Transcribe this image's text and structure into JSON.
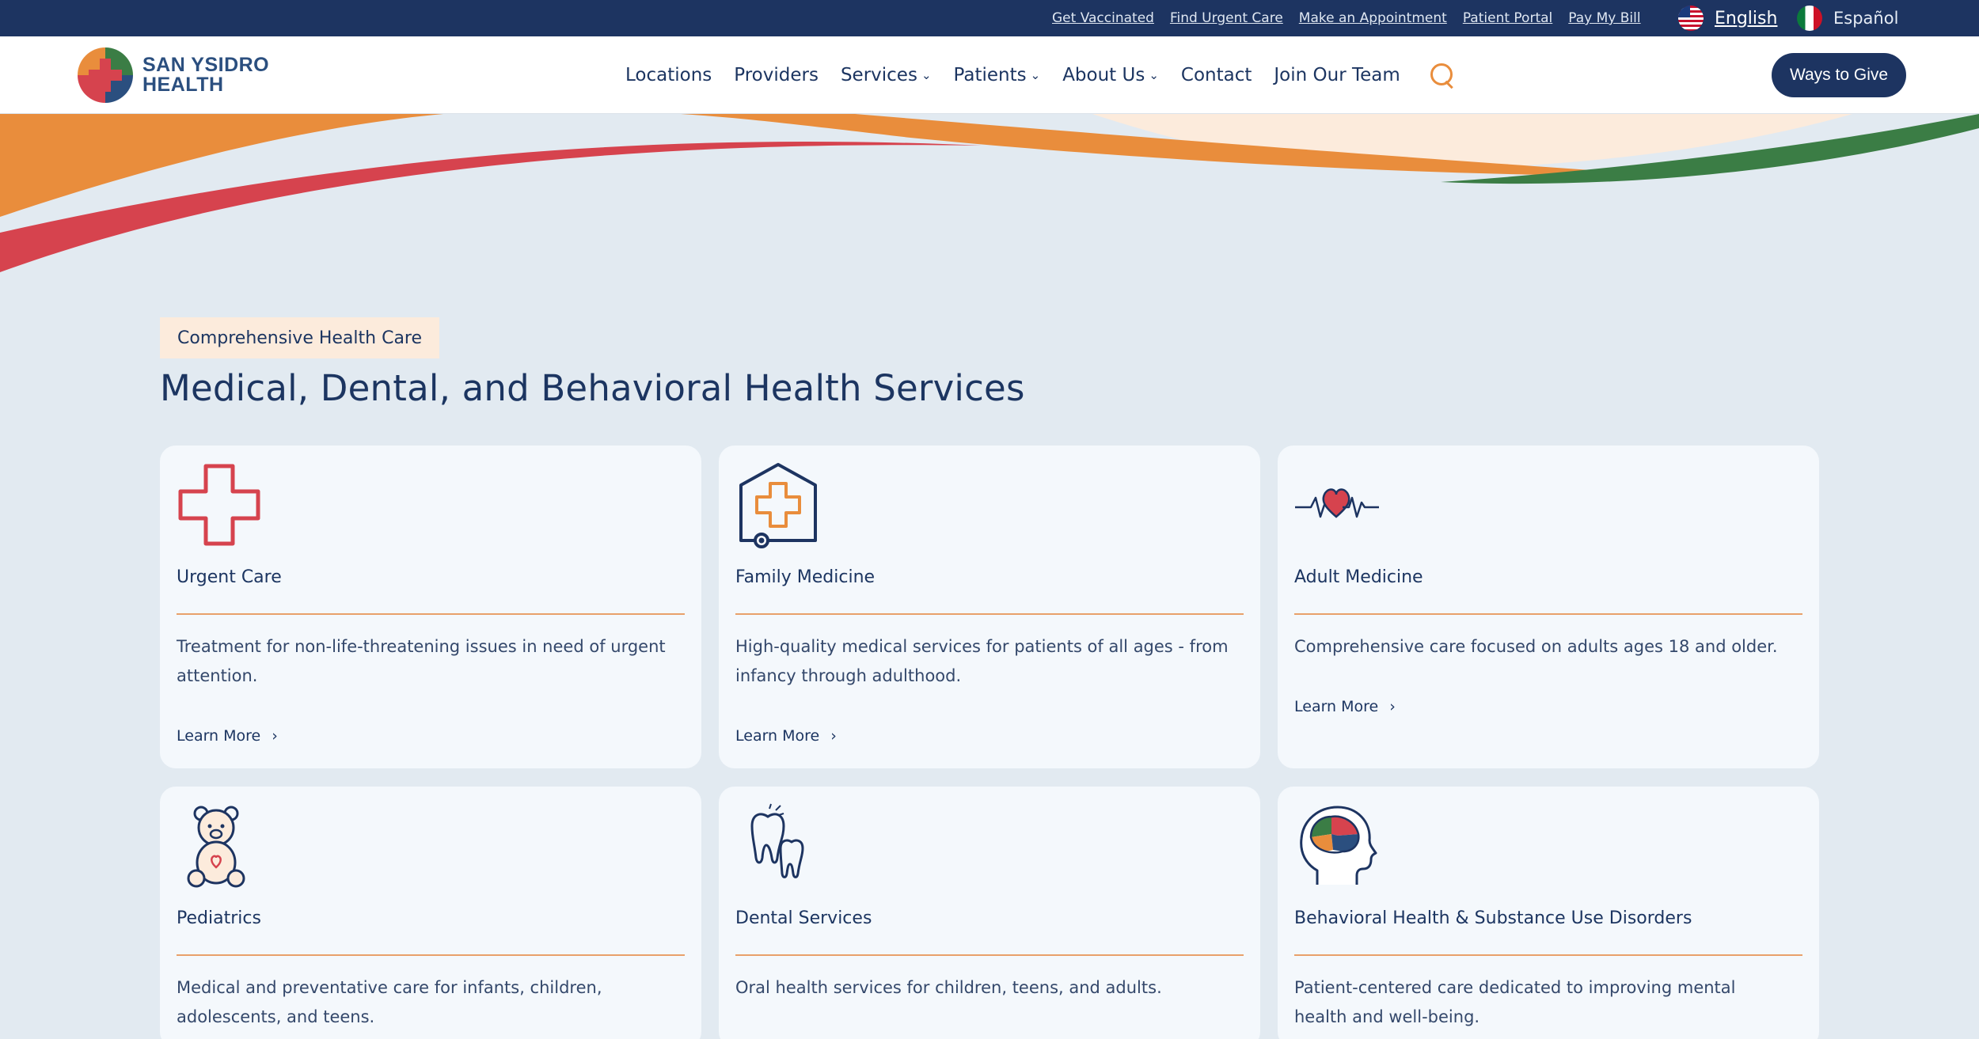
{
  "utility": {
    "links": [
      "Get Vaccinated",
      "Find Urgent Care",
      "Make an Appointment",
      "Patient Portal",
      "Pay My Bill"
    ],
    "lang_en": "English",
    "lang_es": "Español"
  },
  "header": {
    "logo_line1": "SAN YSIDRO",
    "logo_line2": "HEALTH",
    "nav": [
      "Locations",
      "Providers",
      "Services",
      "Patients",
      "About Us",
      "Contact",
      "Join Our Team"
    ],
    "ways_to_give": "Ways to Give"
  },
  "main": {
    "eyebrow": "Comprehensive Health Care",
    "title": "Medical, Dental, and Behavioral Health Services",
    "learn_more": "Learn More",
    "cards": [
      {
        "title": "Urgent Care",
        "desc": "Treatment for non-life-threatening issues in need of urgent attention.",
        "icon": "medical-cross-icon"
      },
      {
        "title": "Family Medicine",
        "desc": "High-quality medical services for patients of all ages - from infancy through adulthood.",
        "icon": "clinic-cross-icon"
      },
      {
        "title": "Adult Medicine",
        "desc": "Comprehensive care focused on adults ages 18 and older.",
        "icon": "heart-pulse-icon"
      },
      {
        "title": "Pediatrics",
        "desc": "Medical and preventative care for infants, children, adolescents, and teens.",
        "icon": "teddy-bear-icon"
      },
      {
        "title": "Dental Services",
        "desc": "Oral health services for children, teens, and adults.",
        "icon": "tooth-icon"
      },
      {
        "title": "Behavioral Health & Substance Use Disorders",
        "desc": "Patient-centered care dedicated to improving mental health and well-being.",
        "icon": "brain-puzzle-icon"
      }
    ]
  },
  "colors": {
    "navy": "#1d3461",
    "orange": "#e98d3c",
    "red": "#d6434e",
    "green": "#3b7d45",
    "background": "#e2eaf1",
    "card": "#f4f8fc"
  }
}
